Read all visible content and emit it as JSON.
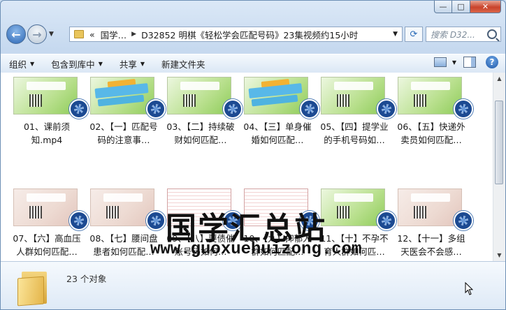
{
  "window": {
    "caption": {
      "minimize": "—",
      "maximize": "□",
      "close": "✕"
    }
  },
  "address": {
    "crumbs": [
      "«",
      "国学…",
      "D32852 明棋《轻松学会匹配号码》23集视频约15小时"
    ],
    "search_placeholder": "搜索 D32..."
  },
  "toolbar": {
    "organize": "组织",
    "include": "包含到库中",
    "share": "共享",
    "new_folder": "新建文件夹"
  },
  "files": [
    {
      "name": "01、课前须知.mp4",
      "thumb": "green"
    },
    {
      "name": "02、【一】匹配号码的注意事…",
      "thumb": "banner"
    },
    {
      "name": "03、【二】持续破财如何匹配…",
      "thumb": "green"
    },
    {
      "name": "04、【三】单身催婚如何匹配…",
      "thumb": "banner"
    },
    {
      "name": "05、【四】提学业的手机号码如…",
      "thumb": "green"
    },
    {
      "name": "06、【五】快递外卖员如何匹配…",
      "thumb": "green"
    },
    {
      "name": "07、【六】高血压人群如何匹配…",
      "thumb": "pink"
    },
    {
      "name": "08、【七】腰间盘患者如何匹配…",
      "thumb": "pink"
    },
    {
      "name": "09、【八】要债催账号码如何…",
      "thumb": "table"
    },
    {
      "name": "10、【九】抑郁人群如何匹配…",
      "thumb": "table"
    },
    {
      "name": "11、【十】不孕不育人群如何匹…",
      "thumb": "green"
    },
    {
      "name": "12、【十一】多组天医会不会感…",
      "thumb": "pink"
    }
  ],
  "watermark": {
    "cn": "国学汇总站",
    "url": "www.guoxuehuizong.com"
  },
  "details": {
    "count": "23 个对象"
  }
}
